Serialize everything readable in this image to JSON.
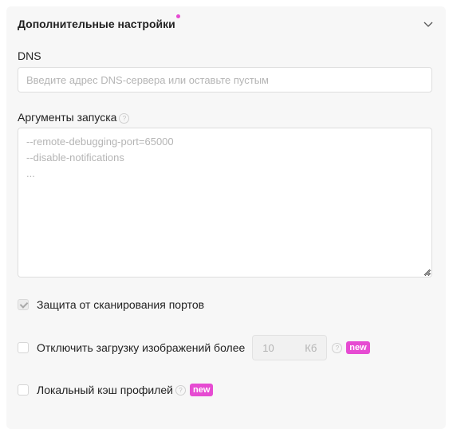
{
  "section": {
    "title": "Дополнительные настройки",
    "indicator_color": "#e64bd2",
    "expand_icon": "chevron-down-icon"
  },
  "dns": {
    "label": "DNS",
    "value": "",
    "placeholder": "Введите адрес DNS-сервера или оставьте пустым"
  },
  "launch_args": {
    "label": "Аргументы запуска",
    "help_icon": "question-circle-icon",
    "value": "",
    "placeholder": "--remote-debugging-port=65000\n--disable-notifications\n..."
  },
  "options": {
    "port_scan": {
      "label": "Защита от сканирования портов",
      "checked": true,
      "disabled": true
    },
    "disable_images": {
      "label": "Отключить загрузку изображений более",
      "checked": false,
      "size_value": "10",
      "size_unit": "Кб",
      "badge": "new"
    },
    "local_cache": {
      "label": "Локальный кэш профилей",
      "checked": false,
      "badge": "new"
    }
  },
  "colors": {
    "accent": "#e64bd2",
    "panel_bg": "#f7f7f7"
  }
}
